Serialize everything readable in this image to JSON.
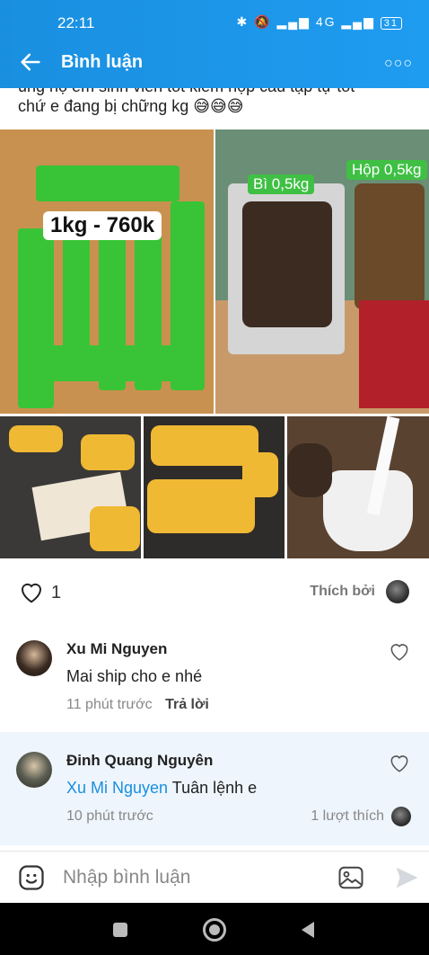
{
  "status_bar": {
    "time": "22:11",
    "signal": "4G",
    "battery": "31"
  },
  "header": {
    "title": "Bình luận"
  },
  "post": {
    "text_line1": "ủng hộ em sinh viên tốt kiếm hộp cầu tập tự tốt",
    "text_line2": "chứ e đang bị chững kg 😅😅😅",
    "photos": {
      "photo1_label": "1kg - 760k",
      "photo2_tag1": "Bì 0,5kg",
      "photo2_tag2": "Hộp 0,5kg"
    }
  },
  "reaction": {
    "like_count": "1",
    "liked_by_label": "Thích bởi"
  },
  "comments": [
    {
      "name": "Xu Mi Nguyen",
      "mention": "",
      "text": "Mai ship cho e nhé",
      "time": "11 phút trước",
      "reply_label": "Trả lời",
      "likes": ""
    },
    {
      "name": "Đinh Quang Nguyên",
      "mention": "Xu Mi Nguyen",
      "text": " Tuân lệnh e",
      "time": "10 phút trước",
      "reply_label": "",
      "likes": "1 lượt thích"
    }
  ],
  "input": {
    "placeholder": "Nhập bình luận"
  },
  "colors": {
    "accent": "#1a8fe0",
    "like_green": "#3fc044"
  }
}
